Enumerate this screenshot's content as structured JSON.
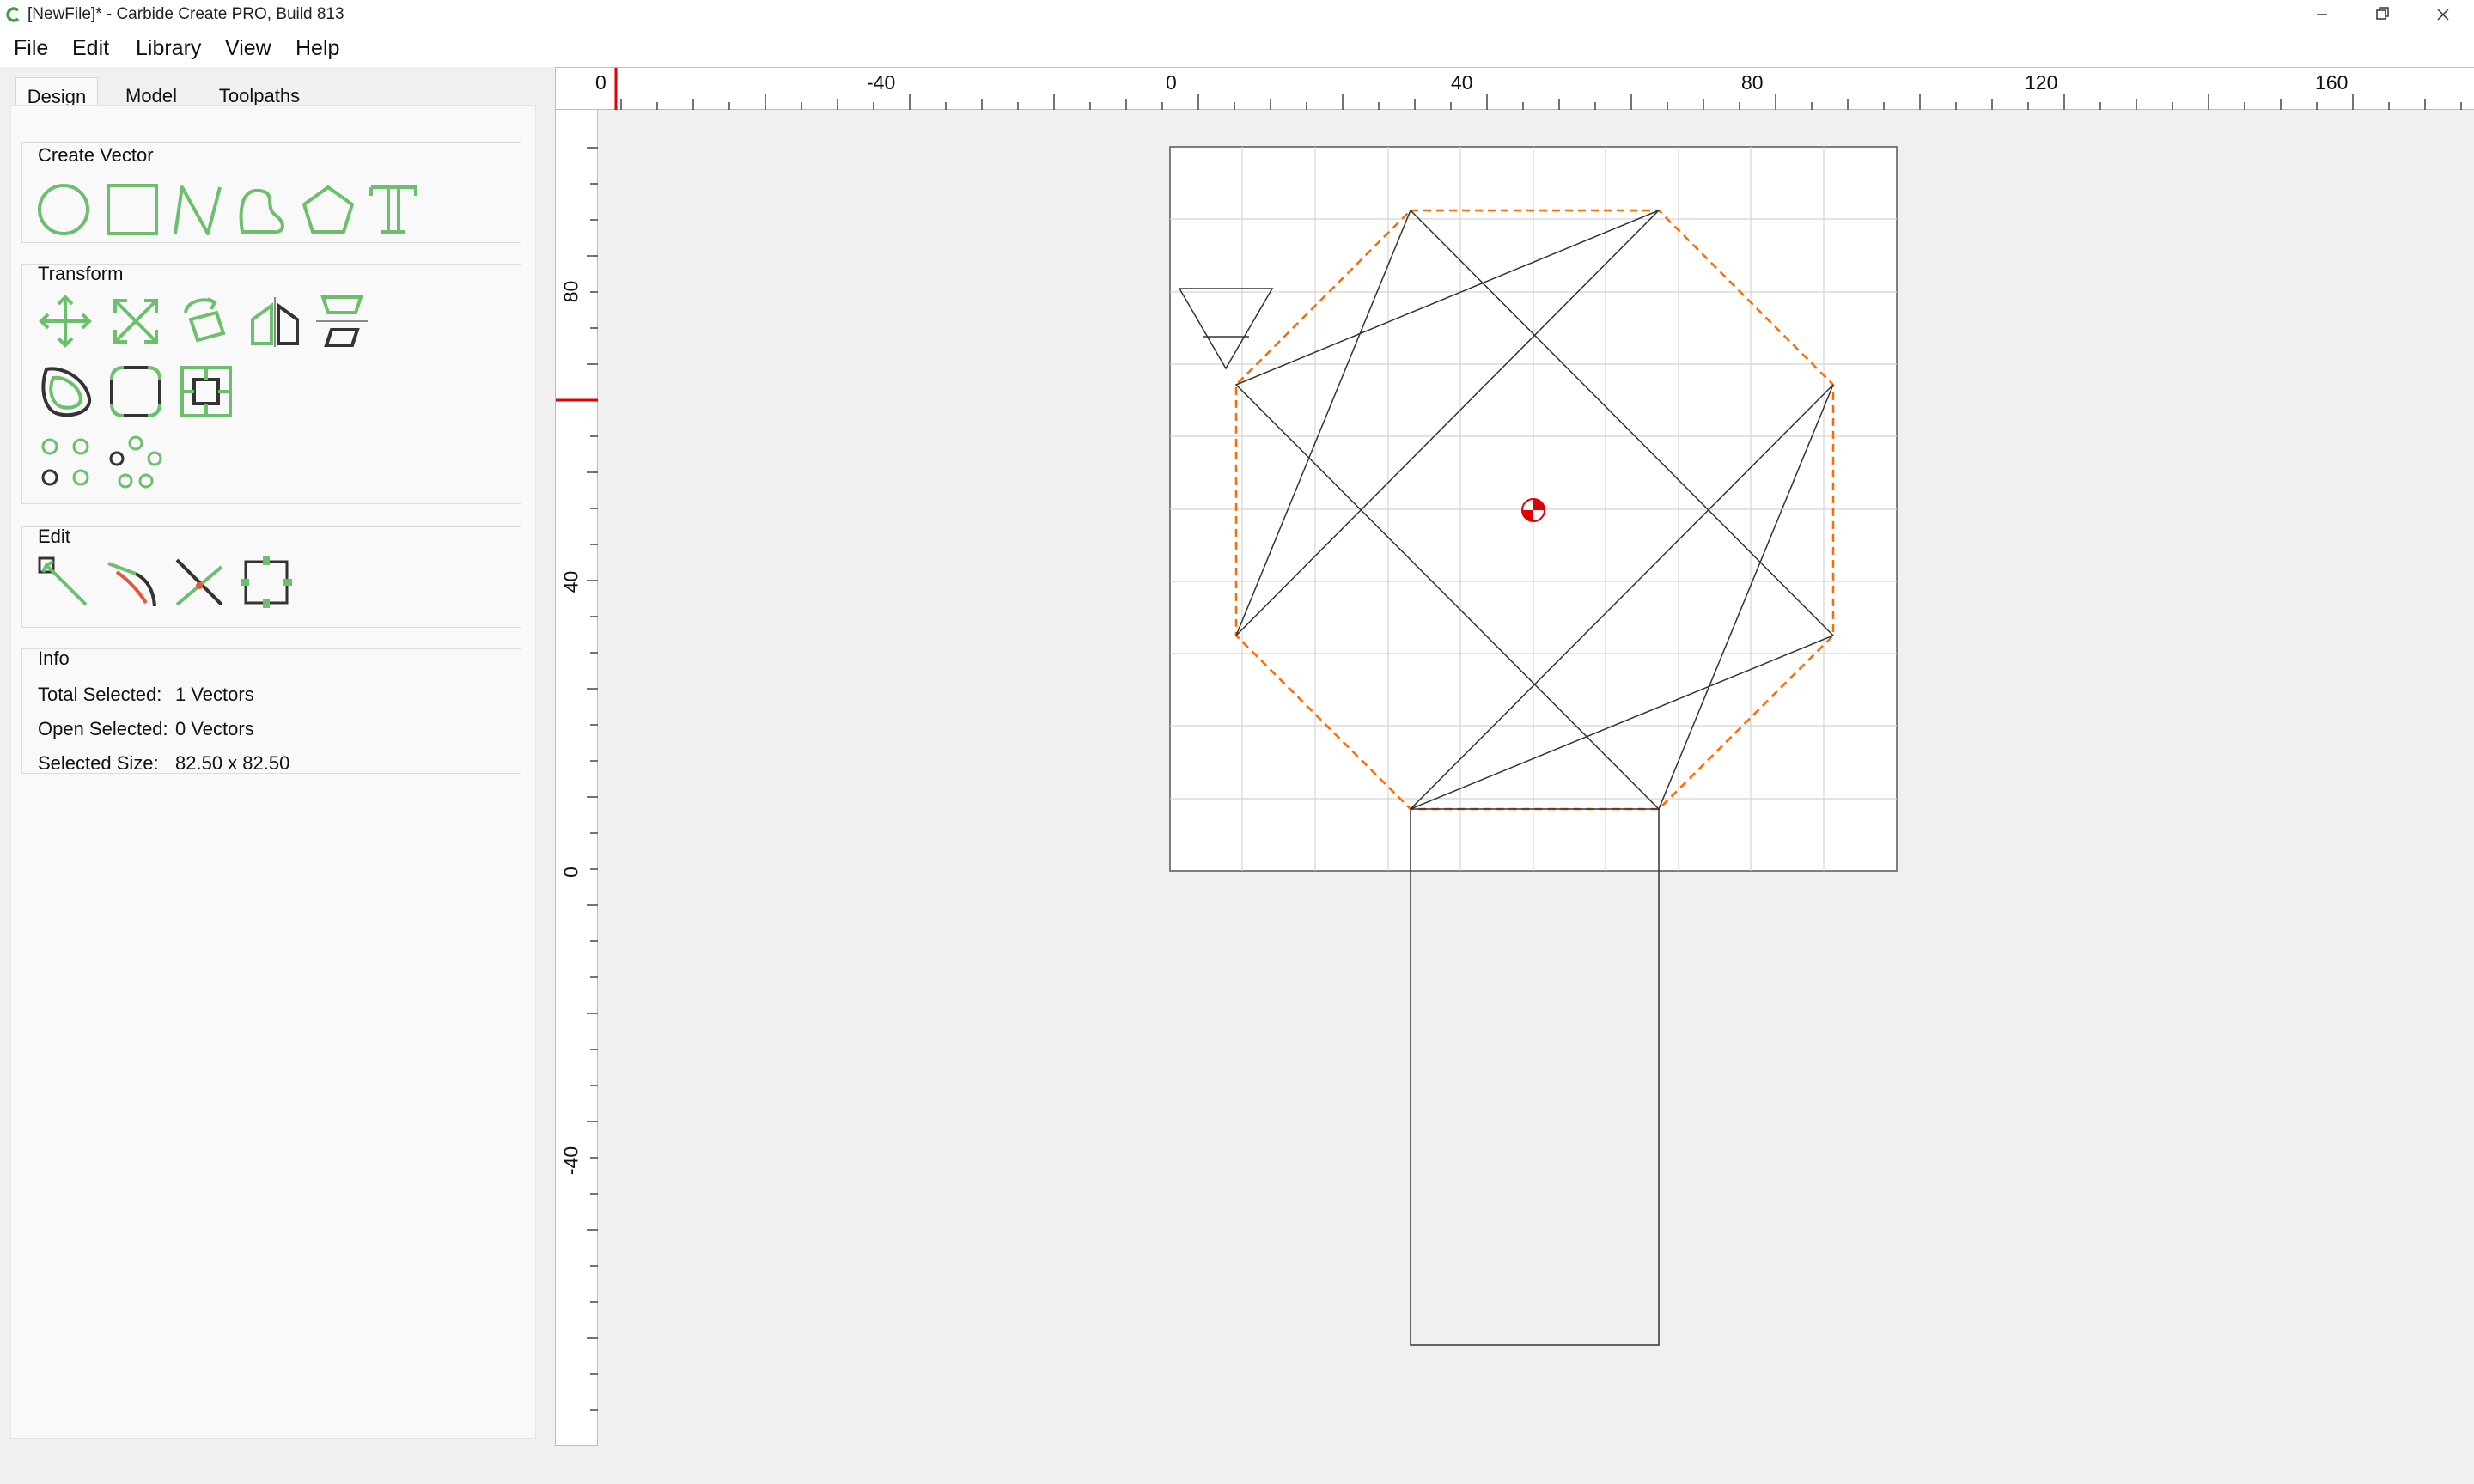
{
  "window": {
    "title": "[NewFile]* - Carbide Create PRO, Build 813",
    "controls": [
      "minimize",
      "restore",
      "close"
    ]
  },
  "menu": {
    "file": "File",
    "edit": "Edit",
    "library": "Library",
    "view": "View",
    "help": "Help"
  },
  "tabs": {
    "design": "Design",
    "model": "Model",
    "toolpaths": "Toolpaths",
    "active": "Design"
  },
  "create_vector": {
    "title": "Create Vector",
    "tools": [
      "circle-icon",
      "rectangle-icon",
      "polyline-icon",
      "curve-icon",
      "polygon-icon",
      "text-icon"
    ]
  },
  "transform": {
    "title": "Transform",
    "tools": [
      "move-icon",
      "scale-icon",
      "rotate-icon",
      "mirror-icon",
      "align-icon",
      "offset-icon",
      "fillet-icon",
      "boolean-icon",
      "grid-array-icon",
      "circular-array-icon"
    ]
  },
  "edit_group": {
    "title": "Edit",
    "tools": [
      "node-edit-icon",
      "join-icon",
      "trim-icon",
      "bounding-box-icon"
    ]
  },
  "info": {
    "title": "Info",
    "total_selected_label": "Total Selected:",
    "total_selected_value": "1 Vectors",
    "open_selected_label": "Open Selected:",
    "open_selected_value": "0 Vectors",
    "selected_size_label": "Selected Size:",
    "selected_size_value": "82.50 x 82.50"
  },
  "rulers": {
    "top_labels": [
      "0",
      "-40",
      "0",
      "40",
      "80",
      "120",
      "160"
    ],
    "left_labels": [
      "80",
      "40",
      "0",
      "-40"
    ]
  },
  "colors": {
    "accent_green": "#6cbf6c",
    "selection_orange": "#ff6a00",
    "origin_red": "#e00000",
    "vector_line": "#333333",
    "grid_line": "#d4d4d4"
  }
}
